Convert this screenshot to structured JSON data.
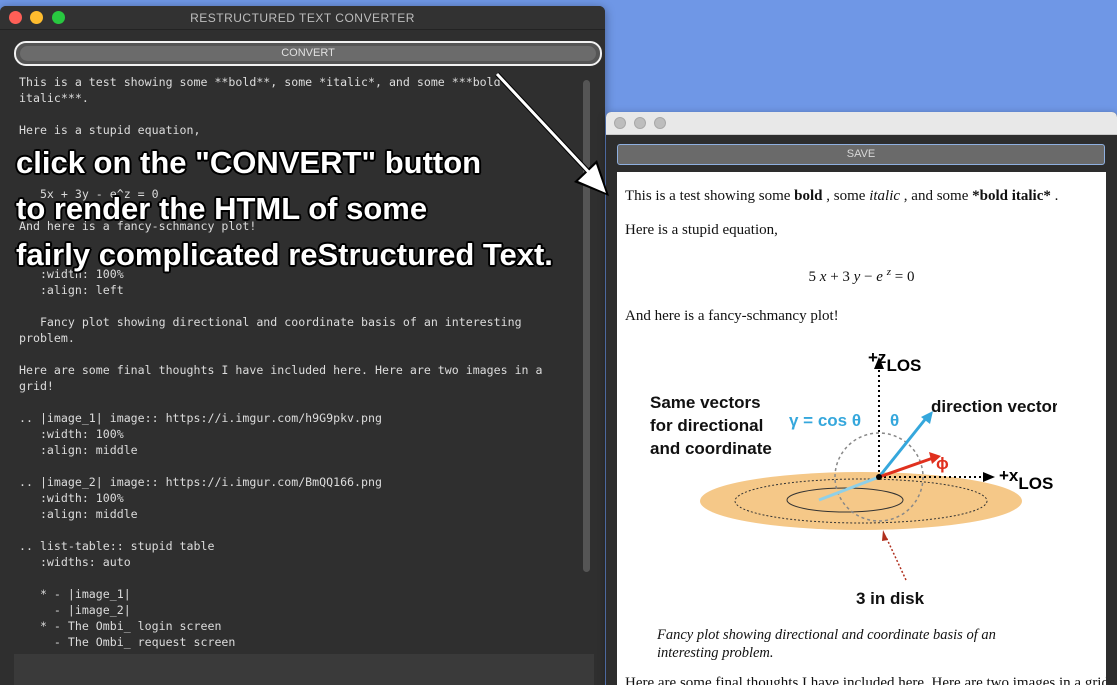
{
  "left_window": {
    "title": "RESTRUCTURED TEXT CONVERTER",
    "convert_label": "CONVERT",
    "editor_lines": [
      "This is a test showing some **bold**, some *italic*, and some ***bold",
      "italic***.",
      "",
      "Here is a stupid equation,",
      "",
      "",
      "",
      "   5x + 3y - e^z = 0",
      "",
      "And here is a fancy-schmancy plot!",
      "",
      "",
      "   :width: 100%",
      "   :align: left",
      "",
      "   Fancy plot showing directional and coordinate basis of an interesting",
      "problem.",
      "",
      "Here are some final thoughts I have included here. Here are two images in a",
      "grid!",
      "",
      ".. |image_1| image:: https://i.imgur.com/h9G9pkv.png",
      "   :width: 100%",
      "   :align: middle",
      "",
      ".. |image_2| image:: https://i.imgur.com/BmQQ166.png",
      "   :width: 100%",
      "   :align: middle",
      "",
      ".. list-table:: stupid table",
      "   :widths: auto",
      "",
      "   * - |image_1|",
      "     - |image_2|",
      "   * - The Ombi_ login screen",
      "     - The Ombi_ request screen"
    ]
  },
  "right_window": {
    "save_label": "SAVE",
    "para1": {
      "a": "This is a test showing some ",
      "bold": "bold",
      "b": " , some ",
      "italic": "italic",
      "c": " , and some ",
      "bold2": "*bold italic*",
      "d": " ."
    },
    "para2": "Here is a stupid equation,",
    "equation": {
      "n5": "5",
      "x": "x",
      "plus": " + 3 ",
      "y": "y",
      "minus": " − ",
      "e": "e",
      "z": "z",
      "eq": " = 0"
    },
    "para3": "And here is a fancy-schmancy plot!",
    "plot": {
      "zlabel": "+z",
      "zsub": "LOS",
      "xlabel": "+x",
      "xsub": "LOS",
      "same1": "Same vectors",
      "same2": "for directional",
      "same3": "and coordinate",
      "gamma": "γ = cos θ",
      "theta": "θ",
      "direction": "direction vector",
      "phi": "ϕ",
      "disk": "3 in disk"
    },
    "caption": "Fancy plot showing directional and coordinate basis of an interesting problem.",
    "para4": "Here are some final thoughts I have included here. Here are two images in a grid!"
  },
  "overlay": {
    "line1": "click on the \"CONVERT\" button",
    "line2": "to render the HTML of some",
    "line3": "fairly complicated reStructured Text."
  },
  "colors": {
    "desktop": "#6f97e6",
    "gamma": "#35a7dc",
    "phi": "#e0301e",
    "disk": "#f5c888"
  }
}
